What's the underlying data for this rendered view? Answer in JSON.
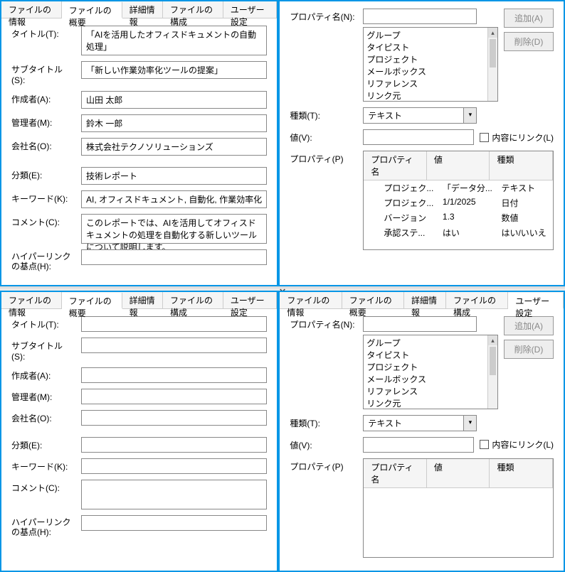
{
  "tabs": [
    {
      "label": "ファイルの情報"
    },
    {
      "label": "ファイルの概要"
    },
    {
      "label": "詳細情報"
    },
    {
      "label": "ファイルの構成"
    },
    {
      "label": "ユーザー設定"
    }
  ],
  "summary": {
    "title_lbl": "タイトル(T):",
    "title": "「AIを活用したオフィスドキュメントの自動処理」",
    "subtitle_lbl": "サブタイトル(S):",
    "subtitle": "「新しい作業効率化ツールの提案」",
    "author_lbl": "作成者(A):",
    "author": "山田 太郎",
    "manager_lbl": "管理者(M):",
    "manager": "鈴木 一郎",
    "company_lbl": "会社名(O):",
    "company": "株式会社テクノソリューションズ",
    "category_lbl": "分類(E):",
    "category": "技術レポート",
    "keywords_lbl": "キーワード(K):",
    "keywords": "AI, オフィスドキュメント, 自動化, 作業効率化",
    "comment_lbl": "コメント(C):",
    "comment": "このレポートでは、AIを活用してオフィスドキュメントの処理を自動化する新しいツールについて説明します。",
    "hyperlink_lbl": "ハイパーリンクの基点(H):"
  },
  "user": {
    "propname_lbl": "プロパティ名(N):",
    "type_lbl": "種類(T):",
    "type_val": "テキスト",
    "value_lbl": "値(V):",
    "link_lbl": "内容にリンク(L)",
    "props_lbl": "プロパティ(P)",
    "add": "追加(A)",
    "del": "削除(D)",
    "listitems": [
      "グループ",
      "タイピスト",
      "プロジェクト",
      "メールボックス",
      "リファレンス",
      "リンク元"
    ],
    "headers": {
      "name": "プロパティ名",
      "val": "値",
      "type": "種類"
    },
    "rows": [
      {
        "name": "プロジェク...",
        "val": "「データ分...",
        "type": "テキスト"
      },
      {
        "name": "プロジェク...",
        "val": "1/1/2025",
        "type": "日付"
      },
      {
        "name": "バージョン",
        "val": "1.3",
        "type": "数値"
      },
      {
        "name": "承認ステ...",
        "val": "はい",
        "type": "はい/いいえ"
      }
    ]
  }
}
